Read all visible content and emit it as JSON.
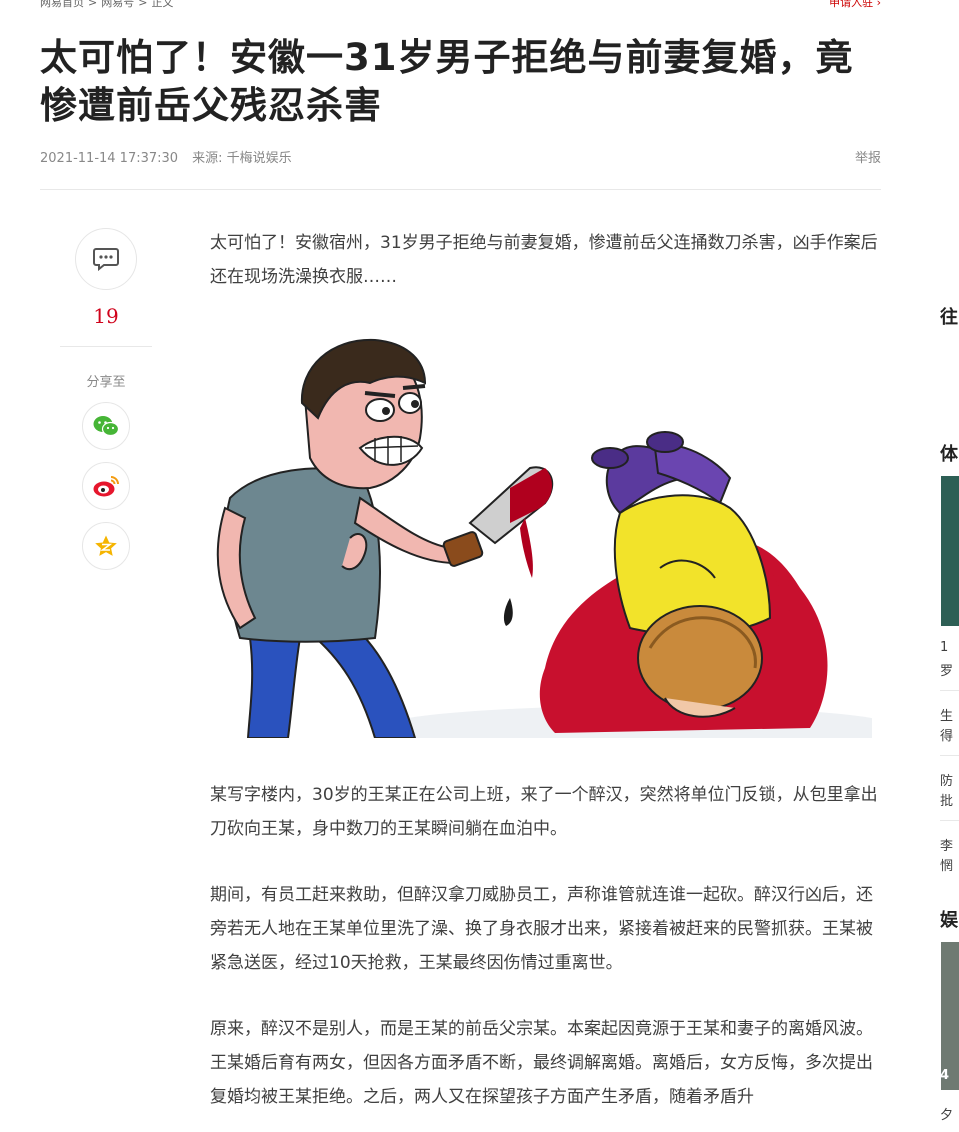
{
  "breadcrumb": {
    "items": [
      "网易首页",
      "网易号",
      "正文"
    ],
    "separator": ">"
  },
  "header": {
    "apply_link": "申请入驻 ›"
  },
  "article": {
    "title": "太可怕了！安徽一31岁男子拒绝与前妻复婚，竟惨遭前岳父残忍杀害",
    "datetime": "2021-11-14 17:37:30",
    "source": "来源: 千梅说娱乐",
    "report": "举报",
    "paragraphs": [
      "太可怕了！安徽宿州，31岁男子拒绝与前妻复婚，惨遭前岳父连捅数刀杀害，凶手作案后还在现场洗澡换衣服……",
      "某写字楼内，30岁的王某正在公司上班，来了一个醉汉，突然将单位门反锁，从包里拿出刀砍向王某，身中数刀的王某瞬间躺在血泊中。",
      "期间，有员工赶来救助，但醉汉拿刀威胁员工，声称谁管就连谁一起砍。醉汉行凶后，还旁若无人地在王某单位里洗了澡、换了身衣服才出来，紧接着被赶来的民警抓获。王某被紧急送医，经过10天抢救，王某最终因伤情过重离世。",
      "原来，醉汉不是别人，而是王某的前岳父宗某。本案起因竟源于王某和妻子的离婚风波。王某婚后育有两女，但因各方面矛盾不断，最终调解离婚。离婚后，女方反悔，多次提出复婚均被王某拒绝。之后，两人又在探望孩子方面产生矛盾，随着矛盾升"
    ]
  },
  "sidebar": {
    "comment_count": "19",
    "share_label": "分享至",
    "share_icons": [
      "wechat-icon",
      "weibo-icon",
      "favorite-icon"
    ]
  },
  "right_column": {
    "headings": [
      "往",
      "体",
      "娱"
    ],
    "lines": [
      "1",
      "罗",
      "生",
      "得",
      "防",
      "批",
      "李",
      "惘",
      "4",
      "夕"
    ]
  },
  "colors": {
    "accent_red": "#d0021b",
    "title": "#222222",
    "body_text": "#404040",
    "meta": "#888888",
    "wechat_green": "#46b536",
    "weibo_red": "#e6162d",
    "favorite_gold": "#f5b400"
  }
}
